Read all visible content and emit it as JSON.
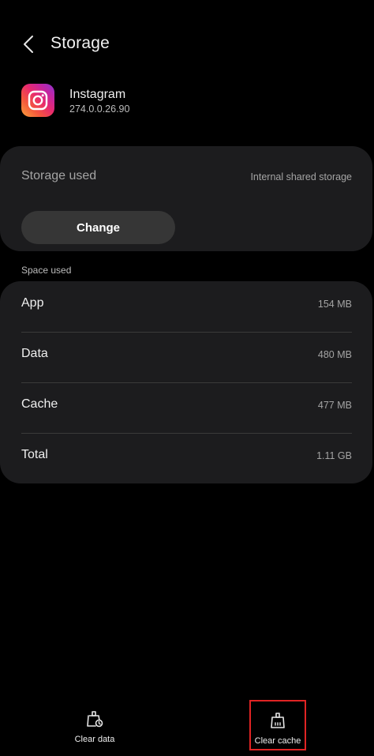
{
  "header": {
    "title": "Storage"
  },
  "app": {
    "name": "Instagram",
    "version": "274.0.0.26.90"
  },
  "storage_card": {
    "label": "Storage used",
    "location": "Internal shared storage",
    "change_label": "Change"
  },
  "space_used": {
    "section_label": "Space used",
    "rows": [
      {
        "label": "App",
        "value": "154 MB"
      },
      {
        "label": "Data",
        "value": "480 MB"
      },
      {
        "label": "Cache",
        "value": "477 MB"
      },
      {
        "label": "Total",
        "value": "1.11 GB"
      }
    ]
  },
  "bottom_bar": {
    "clear_data_label": "Clear data",
    "clear_cache_label": "Clear cache"
  },
  "colors": {
    "background": "#000000",
    "card": "#1c1c1e",
    "button": "#363636",
    "highlight": "#e02424"
  }
}
